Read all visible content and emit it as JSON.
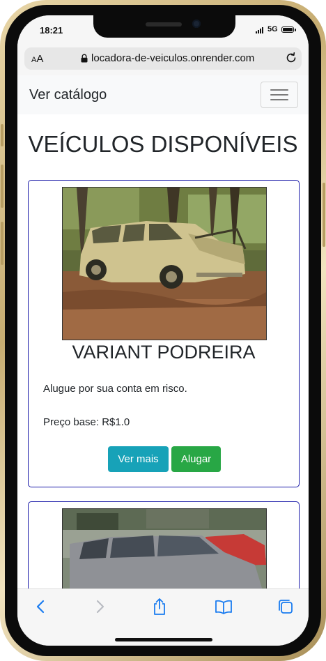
{
  "status_bar": {
    "time": "18:21",
    "network": "5G"
  },
  "browser": {
    "text_size_label_small": "A",
    "text_size_label_large": "A",
    "url": "locadora-de-veiculos.onrender.com"
  },
  "navbar": {
    "brand": "Ver catálogo"
  },
  "page": {
    "title": "VEÍCULOS DISPONÍVEIS"
  },
  "vehicles": [
    {
      "name": "VARIANT PODREIRA",
      "description": "Alugue por sua conta em risco.",
      "price": "Preço base: R$1.0",
      "details_button": "Ver mais",
      "rent_button": "Alugar"
    }
  ],
  "colors": {
    "card_border": "#1a1aa8",
    "details_button": "#17a2b8",
    "rent_button": "#28a745",
    "safari_blue": "#1a7cf0"
  },
  "icons": [
    "lock-icon",
    "reload-icon",
    "hamburger-icon",
    "back-icon",
    "forward-icon",
    "share-icon",
    "bookmarks-icon",
    "tabs-icon"
  ]
}
